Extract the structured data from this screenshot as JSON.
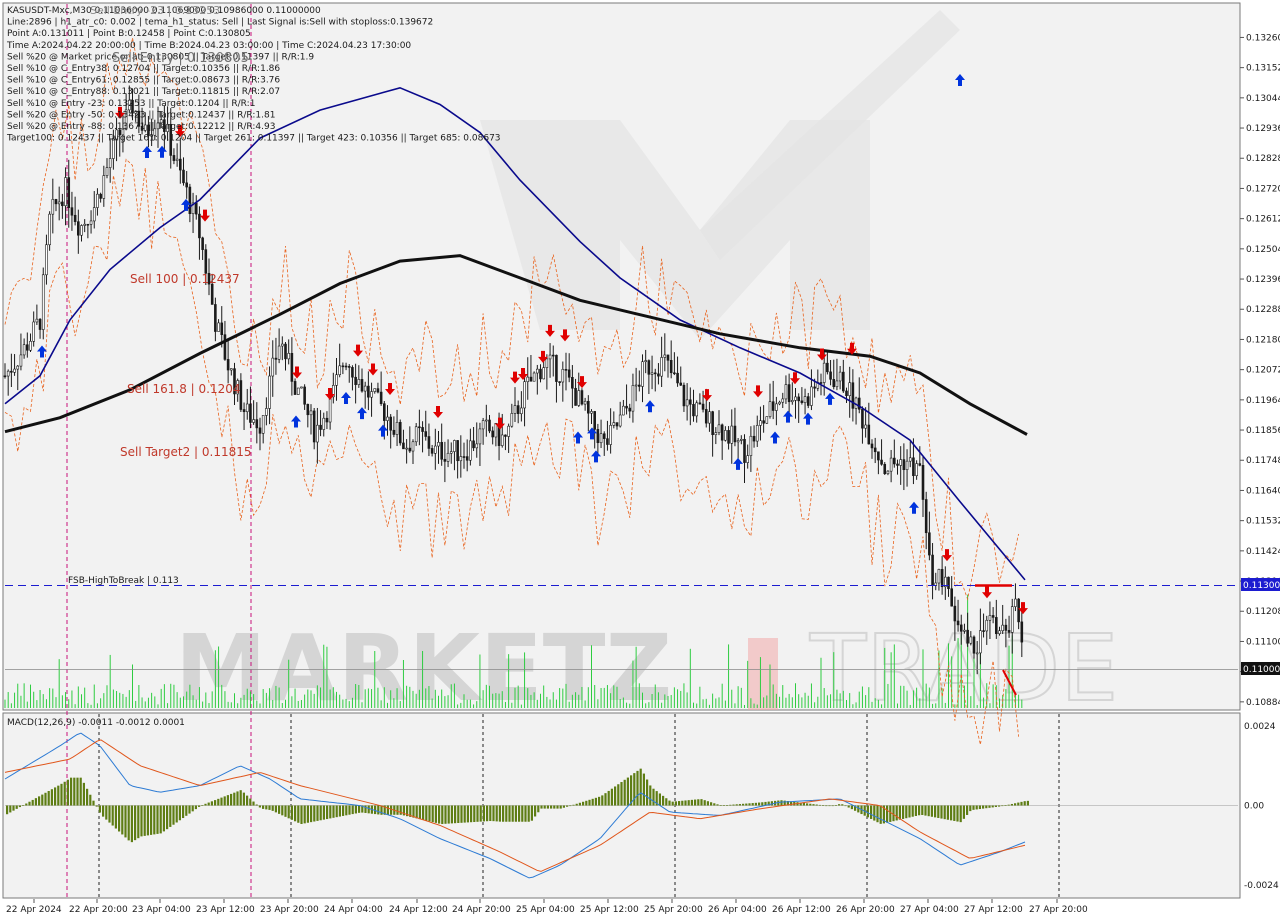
{
  "colors": {
    "background": "#ffffff",
    "chart_area": "#f2f2f2",
    "grid": "#d0d0d0",
    "candle": "#1a1a1a",
    "ma_fast": "#0a0a8c",
    "ma_slow": "#111111",
    "bands": "#e8621c",
    "level_label": "#c0392b",
    "break_line": "#1c1cd0",
    "macd_line": "#2d7bd4",
    "signal_line": "#e0561b",
    "hist": "#5e7d14",
    "volume": "#2ecc40",
    "arrow_down": "#e00000",
    "arrow_up": "#0033dd",
    "session_line": "#c8127a",
    "watermark": "#bdbdbd",
    "watermark_accent": "#f3a9a9"
  },
  "header_lines": [
    "KASUSDT-Mxc,M30  0.11036000 0.11069000 0.10986000 0.11000000",
    "Line:2896  |  h1_atr_c0: 0.002  |  tema_h1_status: Sell  |  Last Signal is:Sell with stoploss:0.139672",
    "Point A:0.131011  |  Point B:0.12458  |  Point C:0.130805",
    "Time A:2024.04.22 20:00:00  |  Time B:2024.04.23 03:00:00  |  Time C:2024.04.23 17:30:00",
    "Sell %20 @ Market price or at: 0.130805  ||  Target:0.11397  ||  R/R:1.9",
    "Sell %10 @ C_Entry38: 0.12704  ||  Target:0.10356  ||  R/R:1.86",
    "Sell %10 @ C_Entry61: 0.12855  ||  Target:0.08673  ||  R/R:3.76",
    "Sell %10 @ C_Entry88: 0.13021  ||  Target:0.11815  ||  R/R:2.07",
    "Sell %10 @ Entry -23: 0.13253  ||  Target:0.1204  ||  R/R:1",
    "Sell %20 @ Entry -50: 0.13423  ||  Target:0.12437  ||  R/R:1.81",
    "Sell %20 @ Entry -88: 0.13671  ||  Target:0.12212  ||  R/R:4.93",
    "Target100: 0.12437  ||  Target 161: 0.1204  ||  Target 261: 0.11397  ||  Target 423: 0.10356  ||  Target 685: 0.08673"
  ],
  "overlay_top_text": "Sell Entry -23 | 0.13253",
  "overlay_mid_text": "Sell Entry | 0.130805",
  "level_labels": [
    {
      "text": "Sell 100 | 0.12437",
      "price": 0.12437
    },
    {
      "text": "Sell 161.8 | 0.1204",
      "price": 0.1204
    },
    {
      "text": "Sell Target2 | 0.11815",
      "price": 0.11815
    }
  ],
  "break_level": {
    "label": "FSB-HighToBreak | 0.113",
    "price": 0.113,
    "tag": "0.11300"
  },
  "current_price": {
    "price": 0.11,
    "tag": "0.11000"
  },
  "price_axis_ticks": [
    "0.13260",
    "0.13152",
    "0.13044",
    "0.12936",
    "0.12828",
    "0.12720",
    "0.12612",
    "0.12504",
    "0.12396",
    "0.12288",
    "0.12180",
    "0.12072",
    "0.11964",
    "0.11856",
    "0.11748",
    "0.11640",
    "0.11532",
    "0.11424",
    "0.11316",
    "0.11208",
    "0.11100",
    "0.10992",
    "0.10884"
  ],
  "price_axis_ticks_shown": [
    "0.13260",
    "0.13152",
    "0.13044",
    "0.12936",
    "0.12828",
    "0.12720",
    "0.12612",
    "0.12504",
    "0.12396",
    "0.12288",
    "0.12180",
    "0.12072",
    "0.11964",
    "0.11856",
    "0.11748",
    "0.11640",
    "0.11532",
    "0.11424",
    "0.11316",
    "0.11208",
    "0.11100",
    "0.10992",
    "0.10884"
  ],
  "macd_label": "MACD(12,26,9) -0.0011 -0.0012 0.0001",
  "macd_axis": [
    "0.0024",
    "0.00",
    "-0.0024"
  ],
  "time_axis": [
    "22 Apr 2024",
    "22 Apr 20:00",
    "23 Apr 04:00",
    "23 Apr 12:00",
    "23 Apr 20:00",
    "24 Apr 04:00",
    "24 Apr 12:00",
    "24 Apr 20:00",
    "25 Apr 04:00",
    "25 Apr 12:00",
    "25 Apr 20:00",
    "26 Apr 04:00",
    "26 Apr 12:00",
    "26 Apr 20:00",
    "27 Apr 04:00",
    "27 Apr 12:00",
    "27 Apr 20:00"
  ],
  "watermark_left": "MARKETZ",
  "watermark_right": "TRADE",
  "price_range": [
    0.10862,
    0.13376
  ],
  "macd_range": [
    -0.0027,
    0.0027
  ]
}
